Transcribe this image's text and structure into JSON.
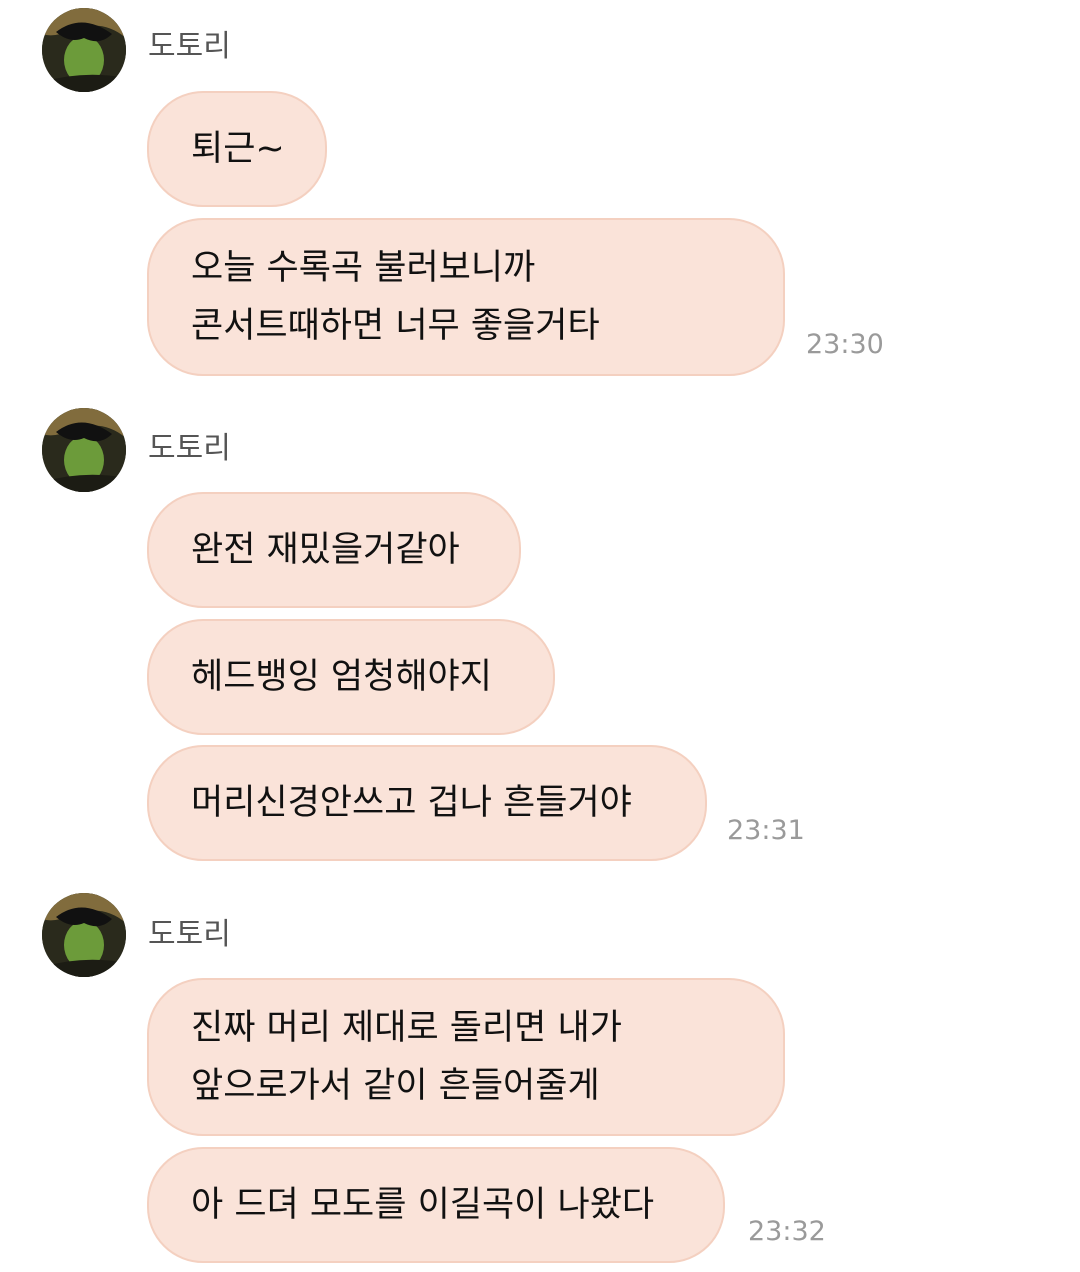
{
  "colors": {
    "bubble_fill": "#fae3d9",
    "bubble_border": "#f4d0c0",
    "timestamp": "#9a9a9a",
    "sender_name": "#555555"
  },
  "groups": [
    {
      "sender": "도토리",
      "avatar_icon": "profile-avatar",
      "messages": [
        {
          "lines": [
            "퇴근~"
          ]
        },
        {
          "lines": [
            "오늘 수록곡 불러보니까",
            "콘서트때하면 너무 좋을거타"
          ]
        }
      ],
      "time": "23:30"
    },
    {
      "sender": "도토리",
      "avatar_icon": "profile-avatar",
      "messages": [
        {
          "lines": [
            "완전 재밌을거같아"
          ]
        },
        {
          "lines": [
            "헤드뱅잉 엄청해야지"
          ]
        },
        {
          "lines": [
            "머리신경안쓰고 겁나 흔들거야"
          ]
        }
      ],
      "time": "23:31"
    },
    {
      "sender": "도토리",
      "avatar_icon": "profile-avatar",
      "messages": [
        {
          "lines": [
            "진짜 머리 제대로 돌리면 내가",
            "앞으로가서 같이 흔들어줄게"
          ]
        },
        {
          "lines": [
            "아 드뎌 모도를 이길곡이 나왔다"
          ]
        }
      ],
      "time": "23:32"
    }
  ]
}
